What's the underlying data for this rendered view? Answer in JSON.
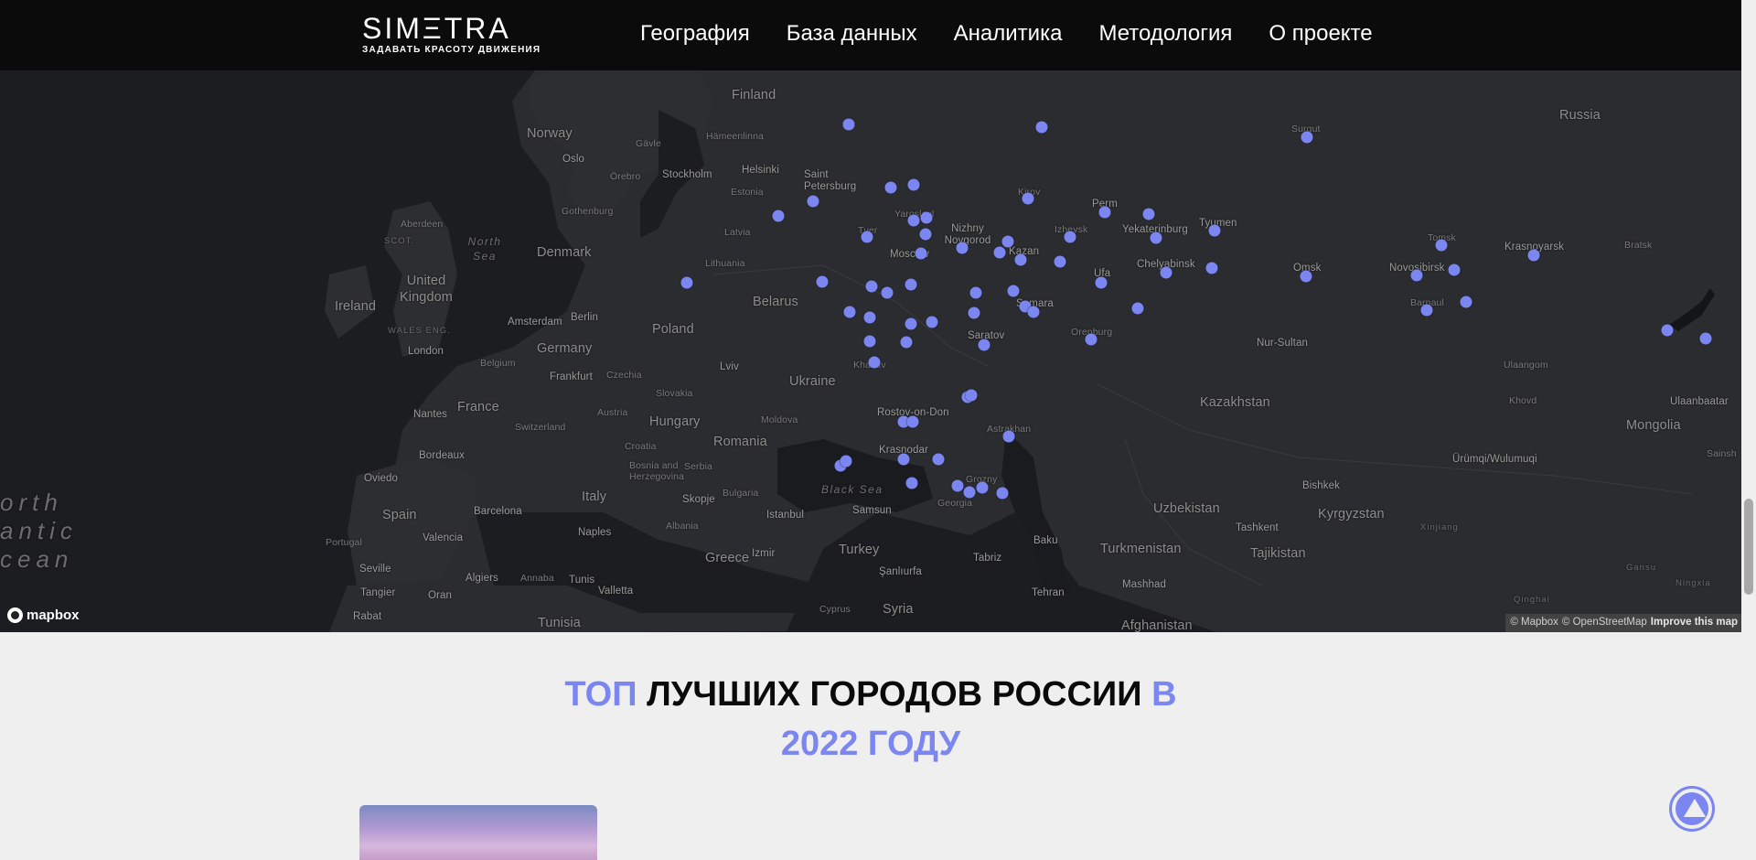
{
  "header": {
    "brand": "SIMΞTRA",
    "tagline": "ЗАДАВАТЬ КРАСОТУ ДВИЖЕНИЯ",
    "nav": [
      "География",
      "База данных",
      "Аналитика",
      "Методология",
      "О проекте"
    ]
  },
  "map": {
    "labels": {
      "countries": [
        "Finland",
        "Norway",
        "Russia",
        "Denmark",
        "United Kingdom",
        "Ireland",
        "Germany",
        "Poland",
        "Belarus",
        "Ukraine",
        "France",
        "Hungary",
        "Romania",
        "Italy",
        "Spain",
        "Portugal",
        "Turkey",
        "Syria",
        "Tunisia",
        "Greece",
        "Kazakhstan",
        "Mongolia",
        "Uzbekistan",
        "Kyrgyzstan",
        "Turkmenistan",
        "Tajikistan",
        "Afghanistan"
      ],
      "cities": [
        "Oslo",
        "Gävle",
        "Örebro",
        "Stockholm",
        "Hämeenlinna",
        "Helsinki",
        "Saint Petersburg",
        "Gothenburg",
        "Aberdeen",
        "Estonia",
        "Latvia",
        "Lithuania",
        "Berlin",
        "Amsterdam",
        "London",
        "Belgium",
        "Frankfurt",
        "Czechia",
        "Slovakia",
        "Lviv",
        "Austria",
        "Moldova",
        "Switzerland",
        "Nantes",
        "Bordeaux",
        "Croatia",
        "Bosnia and Herzegovina",
        "Serbia",
        "Bulgaria",
        "Skopje",
        "Albania",
        "Istanbul",
        "Samsun",
        "Naples",
        "Barcelona",
        "Valencia",
        "Oviedo",
        "Seville",
        "Tangier",
        "Oran",
        "Algiers",
        "Annaba",
        "Tunis",
        "Valletta",
        "Rabat",
        "Izmir",
        "Şanlıurfa",
        "Cyprus",
        "Tabriz",
        "Tehran",
        "Baku",
        "Mashhad",
        "Georgia",
        "Grozny",
        "Krasnodar",
        "Rostov-on-Don",
        "Astrakhan",
        "Saratov",
        "Kharkiv",
        "Samara",
        "Kazan",
        "Nizhny Novgorod",
        "Yaroslavl",
        "Moscow",
        "Tver",
        "Kirov",
        "Perm",
        "Izhevsk",
        "Ufa",
        "Orenburg",
        "Yekaterinburg",
        "Chelyabinsk",
        "Tyumen",
        "Surgut",
        "Omsk",
        "Tomsk",
        "Novosibirsk",
        "Barnaul",
        "Krasnoyarsk",
        "Bratsk",
        "Nur-Sultan",
        "Ulaangom",
        "Khovd",
        "Ulaanbaatar",
        "Ürümqi/Wulumuqi",
        "Bishkek",
        "Tashkent",
        "Xinjiang",
        "Gansu",
        "Ningxia",
        "Qinghai",
        "Sainsh"
      ],
      "seas": [
        "North Sea",
        "Black Sea"
      ],
      "ocean": [
        "orth",
        "antic",
        "cean"
      ],
      "tiny": [
        "SCOT.",
        "WALES ENG."
      ]
    },
    "logo_text": "mapbox",
    "attribution": {
      "mapbox": "© Mapbox",
      "osm": "© OpenStreetMap",
      "improve": "Improve this map"
    }
  },
  "section": {
    "title_part1": "ТОП",
    "title_part2": "ЛУЧШИХ ГОРОДОВ РОССИИ",
    "title_part3": "В",
    "title_part4": "2022 ГОДУ"
  },
  "colors": {
    "accent": "#7b86f0",
    "header_bg": "#0b0b0b",
    "map_bg": "#222326",
    "page_bg": "#efefef"
  },
  "icons": {
    "scroll_top": "arrow-up-icon",
    "map_logo": "mapbox-logo-icon"
  }
}
